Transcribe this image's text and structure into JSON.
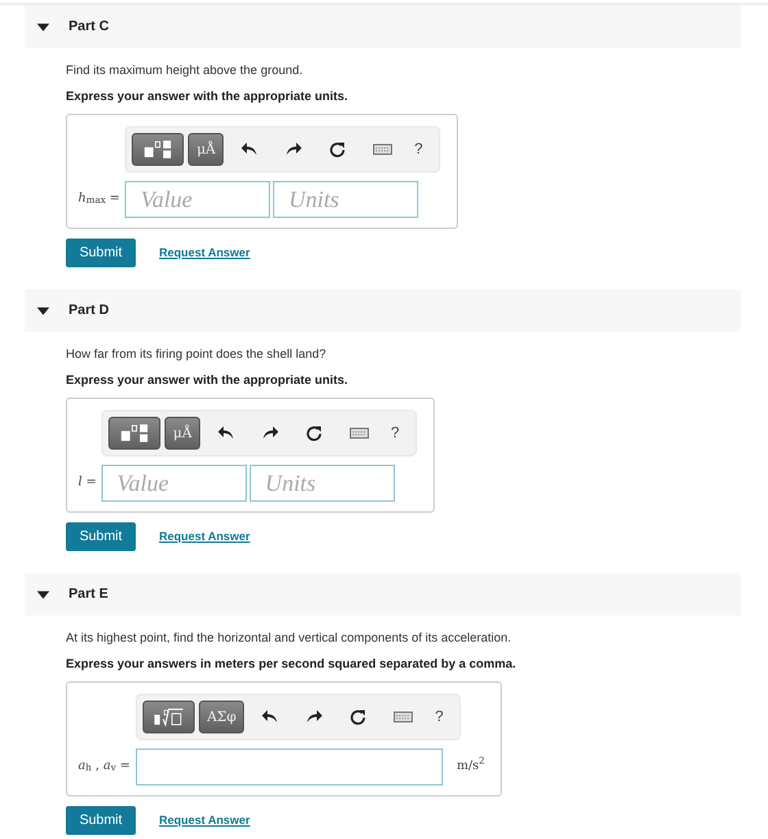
{
  "parts": [
    {
      "label": "Part C",
      "expanded": true,
      "question": "Find its maximum height above the ground.",
      "instruction": "Express your answer with the appropriate units.",
      "toolbar": {
        "kind": "fraction",
        "symbol_button": "μÅ",
        "help": "?"
      },
      "answer": {
        "kind": "value_units",
        "label": "*h*$_{max}$ =",
        "value_placeholder": "Value",
        "units_placeholder": "Units"
      },
      "submit": "Submit",
      "request": "Request Answer"
    },
    {
      "label": "Part D",
      "expanded": true,
      "question": "How far from its firing point does the shell land?",
      "instruction": "Express your answer with the appropriate units.",
      "toolbar": {
        "kind": "fraction",
        "symbol_button": "μÅ",
        "help": "?"
      },
      "answer": {
        "kind": "value_units",
        "label": "*l* =",
        "value_placeholder": "Value",
        "units_placeholder": "Units"
      },
      "submit": "Submit",
      "request": "Request Answer"
    },
    {
      "label": "Part E",
      "expanded": true,
      "question": "At its highest point, find the horizontal and vertical components of its acceleration.",
      "instruction": "Express your answers in meters per second squared separated by a comma.",
      "toolbar": {
        "kind": "root",
        "symbol_button": "ΑΣφ",
        "help": "?"
      },
      "answer": {
        "kind": "single",
        "label": "*a*$_{h}$ , *a*$_{v}$ =",
        "unit": "m/s$^{2}$"
      },
      "submit": "Submit",
      "request": "Request Answer"
    }
  ]
}
